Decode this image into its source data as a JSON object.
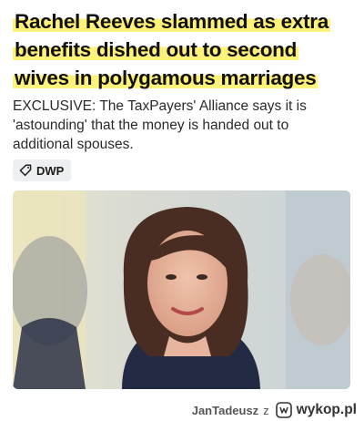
{
  "article": {
    "headline": "Rachel Reeves slammed as extra benefits dished out to second wives in polygamous marriages",
    "standfirst": "EXCLUSIVE: The TaxPayers' Alliance says it is 'astounding' that the money is handed out to additional spouses.",
    "tag": {
      "label": "DWP",
      "icon": "tag-icon"
    },
    "photo": {
      "subject": "woman-portrait"
    }
  },
  "footer": {
    "user": "JanTadeusz",
    "connector": "z",
    "brand": "wykop.pl",
    "brand_icon": "wykop-logo-icon"
  },
  "colors": {
    "highlight": "#fff27a",
    "headline_text": "#111111",
    "tag_background": "#eeeff1"
  }
}
